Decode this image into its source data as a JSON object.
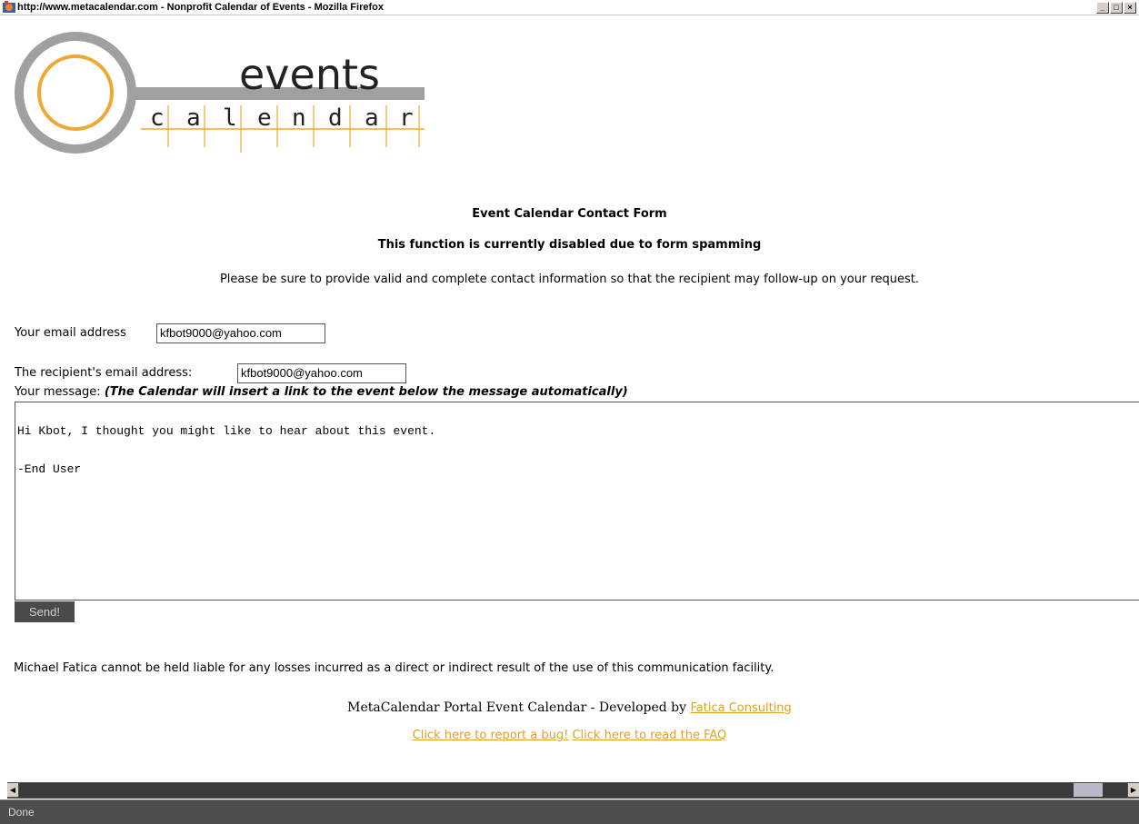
{
  "window": {
    "title": "http://www.metacalendar.com - Nonprofit Calendar of Events - Mozilla Firefox",
    "controls": {
      "minimize": "_",
      "maximize": "□",
      "close": "×"
    }
  },
  "logo": {
    "word1": "events",
    "word2_letters": [
      "c",
      "a",
      "l",
      "e",
      "n",
      "d",
      "a",
      "r"
    ],
    "accent_color": "#f0a830"
  },
  "page": {
    "heading": "Event Calendar Contact Form",
    "subheading": "This function is currently disabled due to form spamming",
    "note": "Please be sure to provide valid and complete contact information so that the recipient may follow-up on your request."
  },
  "form": {
    "email_label": "Your email address",
    "email_value": "kfbot9000@yahoo.com",
    "recipient_label": "The recipient's email address:",
    "recipient_value": "kfbot9000@yahoo.com",
    "message_label": "Your message:",
    "message_hint": "(The Calendar will insert a link to the event below the message automatically)",
    "message_line1": "Hi Kbot, I thought you might like to hear about this event.",
    "message_line2": "-End User",
    "send_label": "Send!"
  },
  "disclaimer": "Michael Fatica cannot be held liable for any losses incurred as a direct or indirect result of the use of this communication facility.",
  "footer": {
    "credit_text": "MetaCalendar Portal Event Calendar - Developed by",
    "credit_link": "Fatica Consulting",
    "bug_link": "Click here to report a bug!",
    "faq_link": "Click here to read the FAQ"
  },
  "status": {
    "text": "Done"
  },
  "colors": {
    "link": "#e0a020",
    "chrome": "#4d4d4d"
  }
}
